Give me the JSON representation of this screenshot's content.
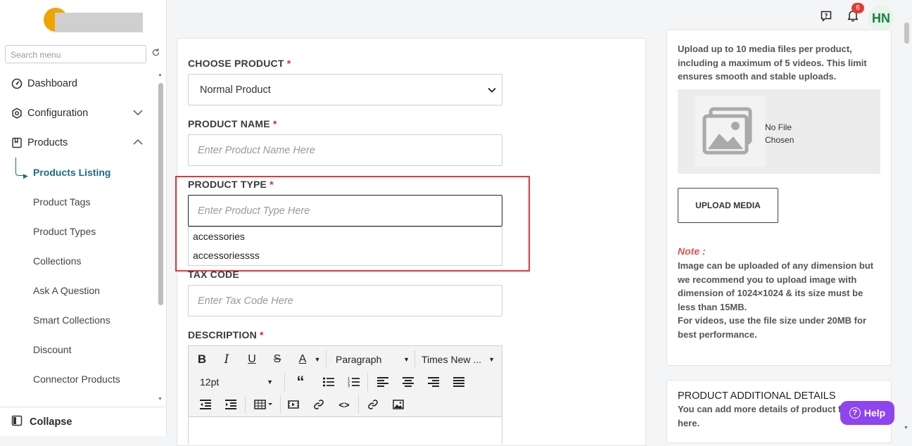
{
  "sidebar": {
    "search_placeholder": "Search menu",
    "items": [
      {
        "label": "Dashboard",
        "icon": "dashboard-icon"
      },
      {
        "label": "Configuration",
        "icon": "gear-icon"
      },
      {
        "label": "Products",
        "icon": "bookmark-icon"
      }
    ],
    "sub_items": [
      "Products Listing",
      "Product Tags",
      "Product Types",
      "Collections",
      "Ask A Question",
      "Smart Collections",
      "Discount",
      "Connector Products"
    ],
    "collapse_label": "Collapse"
  },
  "header": {
    "notification_count": "6",
    "avatar_initials": "HN"
  },
  "form": {
    "choose_product": {
      "label": "CHOOSE PRODUCT",
      "required": "*",
      "value": "Normal Product"
    },
    "product_name": {
      "label": "PRODUCT NAME",
      "required": "*",
      "placeholder": "Enter Product Name Here"
    },
    "product_type": {
      "label": "PRODUCT TYPE",
      "required": "*",
      "placeholder": "Enter Product Type Here",
      "suggestions": [
        "accessories",
        "accessoriessss"
      ]
    },
    "tax_code": {
      "label": "TAX CODE",
      "placeholder": "Enter Tax Code Here"
    },
    "description": {
      "label": "DESCRIPTION",
      "required": "*"
    }
  },
  "editor": {
    "bold": "B",
    "italic": "I",
    "underline": "U",
    "strike": "S",
    "font_color": "A",
    "block_format": "Paragraph",
    "font_family": "Times New ...",
    "font_size": "12pt"
  },
  "media": {
    "info": "Upload up to 10 media files per product, including a maximum of 5 videos. This limit ensures smooth and stable uploads.",
    "no_file_line1": "No File",
    "no_file_line2": "Chosen",
    "upload_button": "UPLOAD MEDIA",
    "note_title": "Note :",
    "note_text_1": "Image can be uploaded of any dimension but we recommend you to upload image with dimension of 1024×1024 & its size must be less than 15MB.",
    "note_text_2": "For videos, use the file size under 20MB for best performance."
  },
  "additional": {
    "title": "PRODUCT ADDITIONAL DETAILS",
    "text": "You can add more details of product from here."
  },
  "help_label": "Help",
  "colors": {
    "accent": "#1c6b8a",
    "required": "#d32f2f",
    "help": "#8e44ef",
    "highlight": "#e53935"
  }
}
